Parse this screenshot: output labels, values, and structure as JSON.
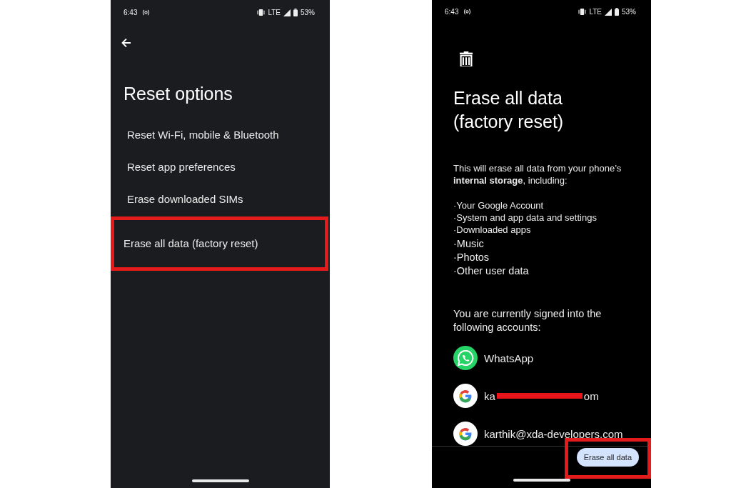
{
  "reset_options_screen": {
    "status_bar": {
      "time": "6:43",
      "network": "LTE",
      "battery": "53%"
    },
    "title": "Reset options",
    "options": [
      {
        "label": "Reset Wi-Fi, mobile & Bluetooth",
        "highlighted": false
      },
      {
        "label": "Reset app preferences",
        "highlighted": false
      },
      {
        "label": "Erase downloaded SIMs",
        "highlighted": false
      },
      {
        "label": "Erase all data (factory reset)",
        "highlighted": true
      }
    ]
  },
  "erase_data_screen": {
    "status_bar": {
      "time": "6:43",
      "network": "LTE",
      "battery": "53%"
    },
    "title_lines": [
      "Erase all data",
      "(factory reset)"
    ],
    "description": "This will erase all data from your phone’s **internal storage**, including:",
    "items_small": [
      "·Your Google Account",
      "·System and app data and settings",
      "·Downloaded apps"
    ],
    "items_large": [
      "·Music",
      "·Photos",
      "·Other user data"
    ],
    "accounts_intro": "You are currently signed into the following accounts:",
    "accounts": [
      {
        "kind": "whatsapp",
        "text": "WhatsApp",
        "redacted": false
      },
      {
        "kind": "google",
        "text": "ka",
        "text_end": "om",
        "redacted": true
      },
      {
        "kind": "google",
        "text": "karthik@xda-developers.com",
        "redacted": false
      }
    ],
    "button": {
      "label": "Erase all data",
      "highlighted": true
    }
  }
}
